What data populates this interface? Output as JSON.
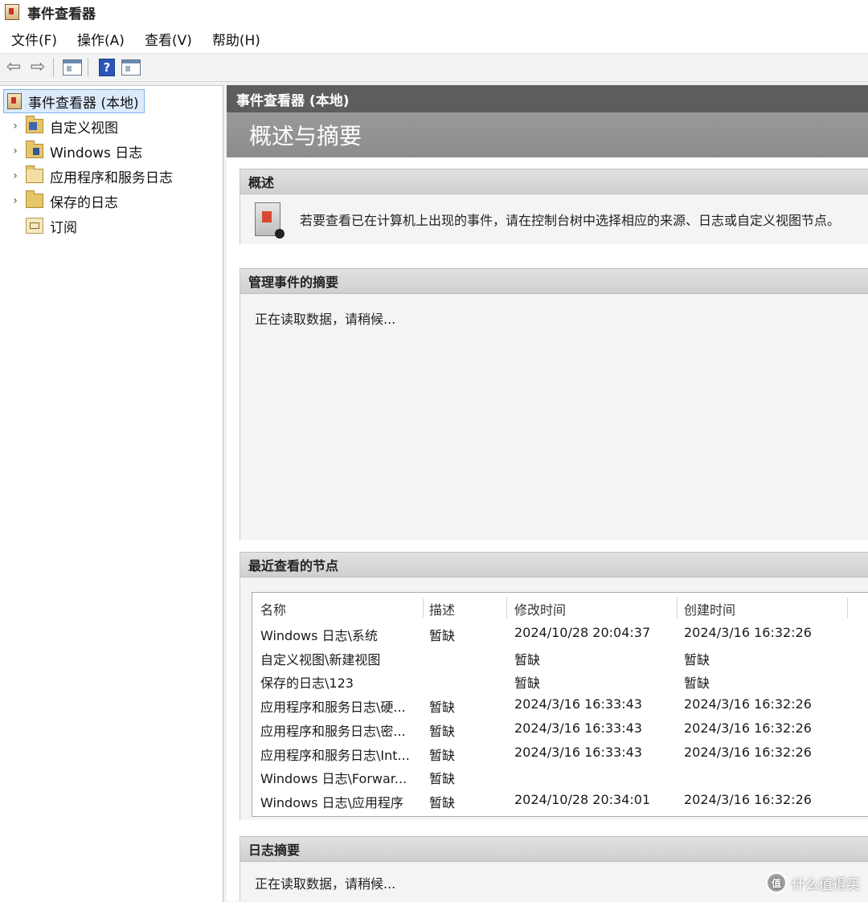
{
  "window": {
    "title": "事件查看器"
  },
  "menu": [
    "文件(F)",
    "操作(A)",
    "查看(V)",
    "帮助(H)"
  ],
  "tree": {
    "root": "事件查看器 (本地)",
    "items": [
      "自定义视图",
      "Windows 日志",
      "应用程序和服务日志",
      "保存的日志",
      "订阅"
    ]
  },
  "main": {
    "header": "事件查看器 (本地)",
    "banner": "概述与摘要",
    "overview": {
      "title": "概述",
      "text": "若要查看已在计算机上出现的事件，请在控制台树中选择相应的来源、日志或自定义视图节点。"
    },
    "admin_summary": {
      "title": "管理事件的摘要",
      "status": "正在读取数据，请稍候..."
    },
    "recent": {
      "title": "最近查看的节点",
      "columns": [
        "名称",
        "描述",
        "修改时间",
        "创建时间"
      ],
      "rows": [
        [
          "Windows 日志\\系统",
          "暂缺",
          "2024/10/28 20:04:37",
          "2024/3/16 16:32:26"
        ],
        [
          "自定义视图\\新建视图",
          "",
          "暂缺",
          "暂缺"
        ],
        [
          "保存的日志\\123",
          "",
          "暂缺",
          "暂缺"
        ],
        [
          "应用程序和服务日志\\硬...",
          "暂缺",
          "2024/3/16 16:33:43",
          "2024/3/16 16:32:26"
        ],
        [
          "应用程序和服务日志\\密...",
          "暂缺",
          "2024/3/16 16:33:43",
          "2024/3/16 16:32:26"
        ],
        [
          "应用程序和服务日志\\Int...",
          "暂缺",
          "2024/3/16 16:33:43",
          "2024/3/16 16:32:26"
        ],
        [
          "Windows 日志\\Forwar...",
          "暂缺",
          "",
          ""
        ],
        [
          "Windows 日志\\应用程序",
          "暂缺",
          "2024/10/28 20:34:01",
          "2024/3/16 16:32:26"
        ]
      ]
    },
    "log_summary": {
      "title": "日志摘要",
      "status": "正在读取数据，请稍候..."
    }
  },
  "watermark": {
    "logo": "值",
    "text": "什么值得买"
  }
}
